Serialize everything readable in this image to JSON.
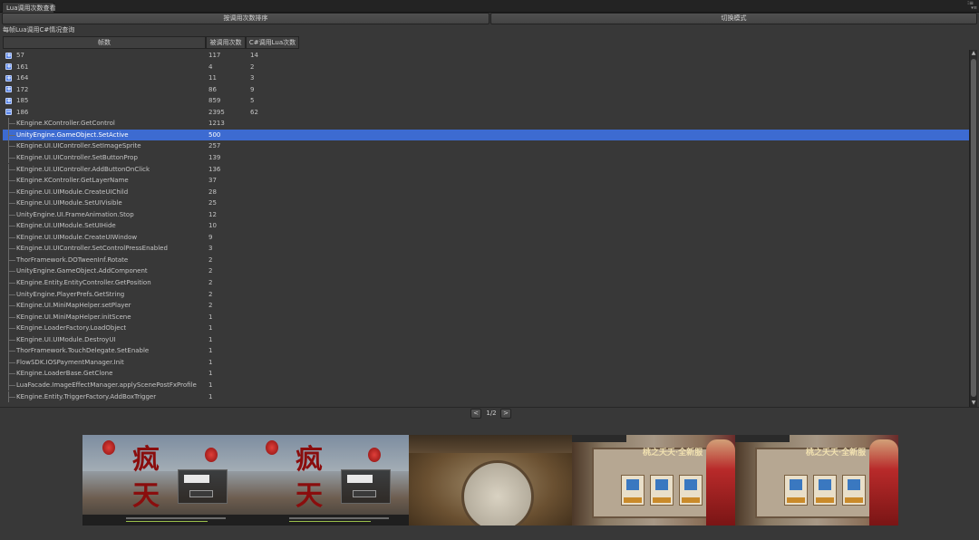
{
  "window": {
    "tab_title": "Lua调用次数查看",
    "menu_glyph": "⁝≡",
    "lock_glyph": "▾≡"
  },
  "toolbar": {
    "sort_button": "按调用次数排序",
    "switch_mode_button": "切换模式"
  },
  "subtitle": "每帧Lua调用C#情况查询",
  "table": {
    "columns": [
      "帧数",
      "被调用次数",
      "C#调用Lua次数"
    ],
    "rows": [
      {
        "kind": "frame",
        "expanded": false,
        "name": "57",
        "calls": "117",
        "lua_calls": "14"
      },
      {
        "kind": "frame",
        "expanded": false,
        "name": "161",
        "calls": "4",
        "lua_calls": "2"
      },
      {
        "kind": "frame",
        "expanded": false,
        "name": "164",
        "calls": "11",
        "lua_calls": "3"
      },
      {
        "kind": "frame",
        "expanded": false,
        "name": "172",
        "calls": "86",
        "lua_calls": "9"
      },
      {
        "kind": "frame",
        "expanded": false,
        "name": "185",
        "calls": "859",
        "lua_calls": "5"
      },
      {
        "kind": "frame",
        "expanded": true,
        "name": "186",
        "calls": "2395",
        "lua_calls": "62"
      },
      {
        "kind": "method",
        "name": "KEngine.KController.GetControl",
        "calls": "1213"
      },
      {
        "kind": "method",
        "selected": true,
        "name": "UnityEngine.GameObject.SetActive",
        "calls": "500"
      },
      {
        "kind": "method",
        "name": "KEngine.UI.UIController.SetImageSprite",
        "calls": "257"
      },
      {
        "kind": "method",
        "name": "KEngine.UI.UIController.SetButtonProp",
        "calls": "139"
      },
      {
        "kind": "method",
        "name": "KEngine.UI.UIController.AddButtonOnClick",
        "calls": "136"
      },
      {
        "kind": "method",
        "name": "KEngine.KController.GetLayerName",
        "calls": "37"
      },
      {
        "kind": "method",
        "name": "KEngine.UI.UIModule.CreateUIChild",
        "calls": "28"
      },
      {
        "kind": "method",
        "name": "KEngine.UI.UIModule.SetUIVisible",
        "calls": "25"
      },
      {
        "kind": "method",
        "name": "UnityEngine.UI.FrameAnimation.Stop",
        "calls": "12"
      },
      {
        "kind": "method",
        "name": "KEngine.UI.UIModule.SetUIHide",
        "calls": "10"
      },
      {
        "kind": "method",
        "name": "KEngine.UI.UIModule.CreateUIWindow",
        "calls": "9"
      },
      {
        "kind": "method",
        "name": "KEngine.UI.UIController.SetControlPressEnabled",
        "calls": "3"
      },
      {
        "kind": "method",
        "name": "ThorFramework.DOTweenInf.Rotate",
        "calls": "2"
      },
      {
        "kind": "method",
        "name": "UnityEngine.GameObject.AddComponent",
        "calls": "2"
      },
      {
        "kind": "method",
        "name": "KEngine.Entity.EntityController.GetPosition",
        "calls": "2"
      },
      {
        "kind": "method",
        "name": "UnityEngine.PlayerPrefs.GetString",
        "calls": "2"
      },
      {
        "kind": "method",
        "name": "KEngine.UI.MiniMapHelper.setPlayer",
        "calls": "2"
      },
      {
        "kind": "method",
        "name": "KEngine.UI.MiniMapHelper.initScene",
        "calls": "1"
      },
      {
        "kind": "method",
        "name": "KEngine.LoaderFactory.LoadObject",
        "calls": "1"
      },
      {
        "kind": "method",
        "name": "KEngine.UI.UIModule.DestroyUI",
        "calls": "1"
      },
      {
        "kind": "method",
        "name": "ThorFramework.TouchDelegate.SetEnable",
        "calls": "1"
      },
      {
        "kind": "method",
        "name": "FlowSDK.IOSPaymentManager.Init",
        "calls": "1"
      },
      {
        "kind": "method",
        "name": "KEngine.LoaderBase.GetClone",
        "calls": "1"
      },
      {
        "kind": "method",
        "name": "LuaFacade.ImageEffectManager.applyScenePostFxProfile",
        "calls": "1"
      },
      {
        "kind": "method",
        "name": "KEngine.Entity.TriggerFactory.AddBoxTrigger",
        "calls": "1"
      }
    ]
  },
  "pager": {
    "prev": "<",
    "next": ">",
    "label": "1/2"
  },
  "thumbnails": {
    "login_logo": "疯天",
    "event_title": "桃之夭夭·全新服",
    "items": [
      "login-screen",
      "login-screen",
      "table-scene",
      "event-screen",
      "event-screen"
    ]
  },
  "colors": {
    "selection": "#3d6bd1",
    "background": "#383838",
    "expand_icon": "#5a86e8"
  }
}
